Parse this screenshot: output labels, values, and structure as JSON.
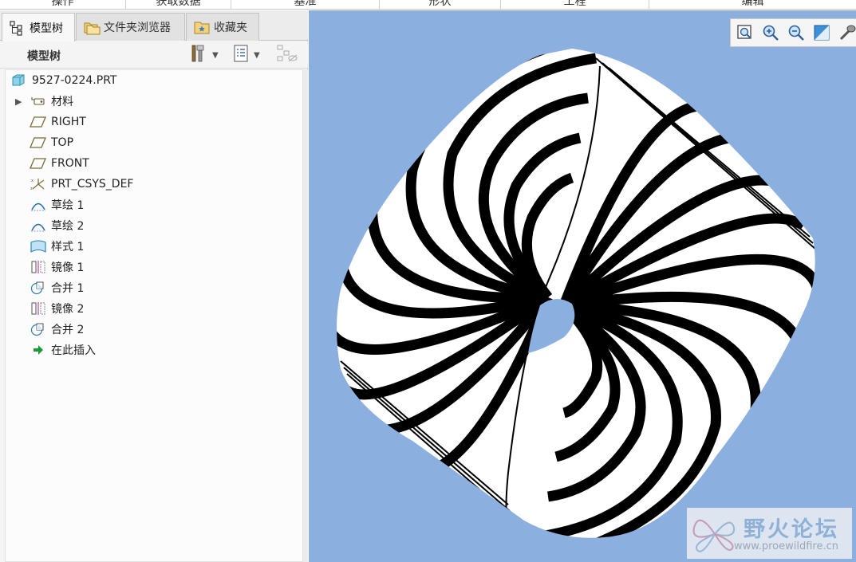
{
  "ribbon": {
    "groups": [
      "操作",
      "获取数据",
      "基准",
      "形状",
      "工程",
      "编辑"
    ]
  },
  "tabs": [
    {
      "label": "模型树",
      "icon": "model-tree-icon",
      "active": true
    },
    {
      "label": "文件夹浏览器",
      "icon": "folder-browser-icon",
      "active": false
    },
    {
      "label": "收藏夹",
      "icon": "favorites-icon",
      "active": false
    }
  ],
  "tree_header": {
    "title": "模型树"
  },
  "tree": {
    "root": {
      "label": "9527-0224.PRT",
      "icon": "part-icon"
    },
    "items": [
      {
        "label": "材料",
        "icon": "material-icon",
        "expandable": true
      },
      {
        "label": "RIGHT",
        "icon": "datum-plane-icon"
      },
      {
        "label": "TOP",
        "icon": "datum-plane-icon"
      },
      {
        "label": "FRONT",
        "icon": "datum-plane-icon"
      },
      {
        "label": "PRT_CSYS_DEF",
        "icon": "coordinate-system-icon"
      },
      {
        "label": "草绘 1",
        "icon": "sketch-icon"
      },
      {
        "label": "草绘 2",
        "icon": "sketch-icon"
      },
      {
        "label": "样式 1",
        "icon": "style-surface-icon"
      },
      {
        "label": "镜像 1",
        "icon": "mirror-icon"
      },
      {
        "label": "合并 1",
        "icon": "merge-icon"
      },
      {
        "label": "镜像 2",
        "icon": "mirror-icon"
      },
      {
        "label": "合并 2",
        "icon": "merge-icon"
      },
      {
        "label": "在此插入",
        "icon": "insert-here-arrow-icon"
      }
    ]
  },
  "view_toolbar": {
    "icons": [
      "zoom-fit-icon",
      "zoom-in-icon",
      "zoom-out-icon",
      "repaint-icon",
      "display-style-icon"
    ]
  },
  "watermark": {
    "title": "野火论坛",
    "url": "www.proewildfire.cn"
  },
  "colors": {
    "viewport_bg": "#8bb0e0",
    "watermark_title": "#8fb1d7"
  }
}
